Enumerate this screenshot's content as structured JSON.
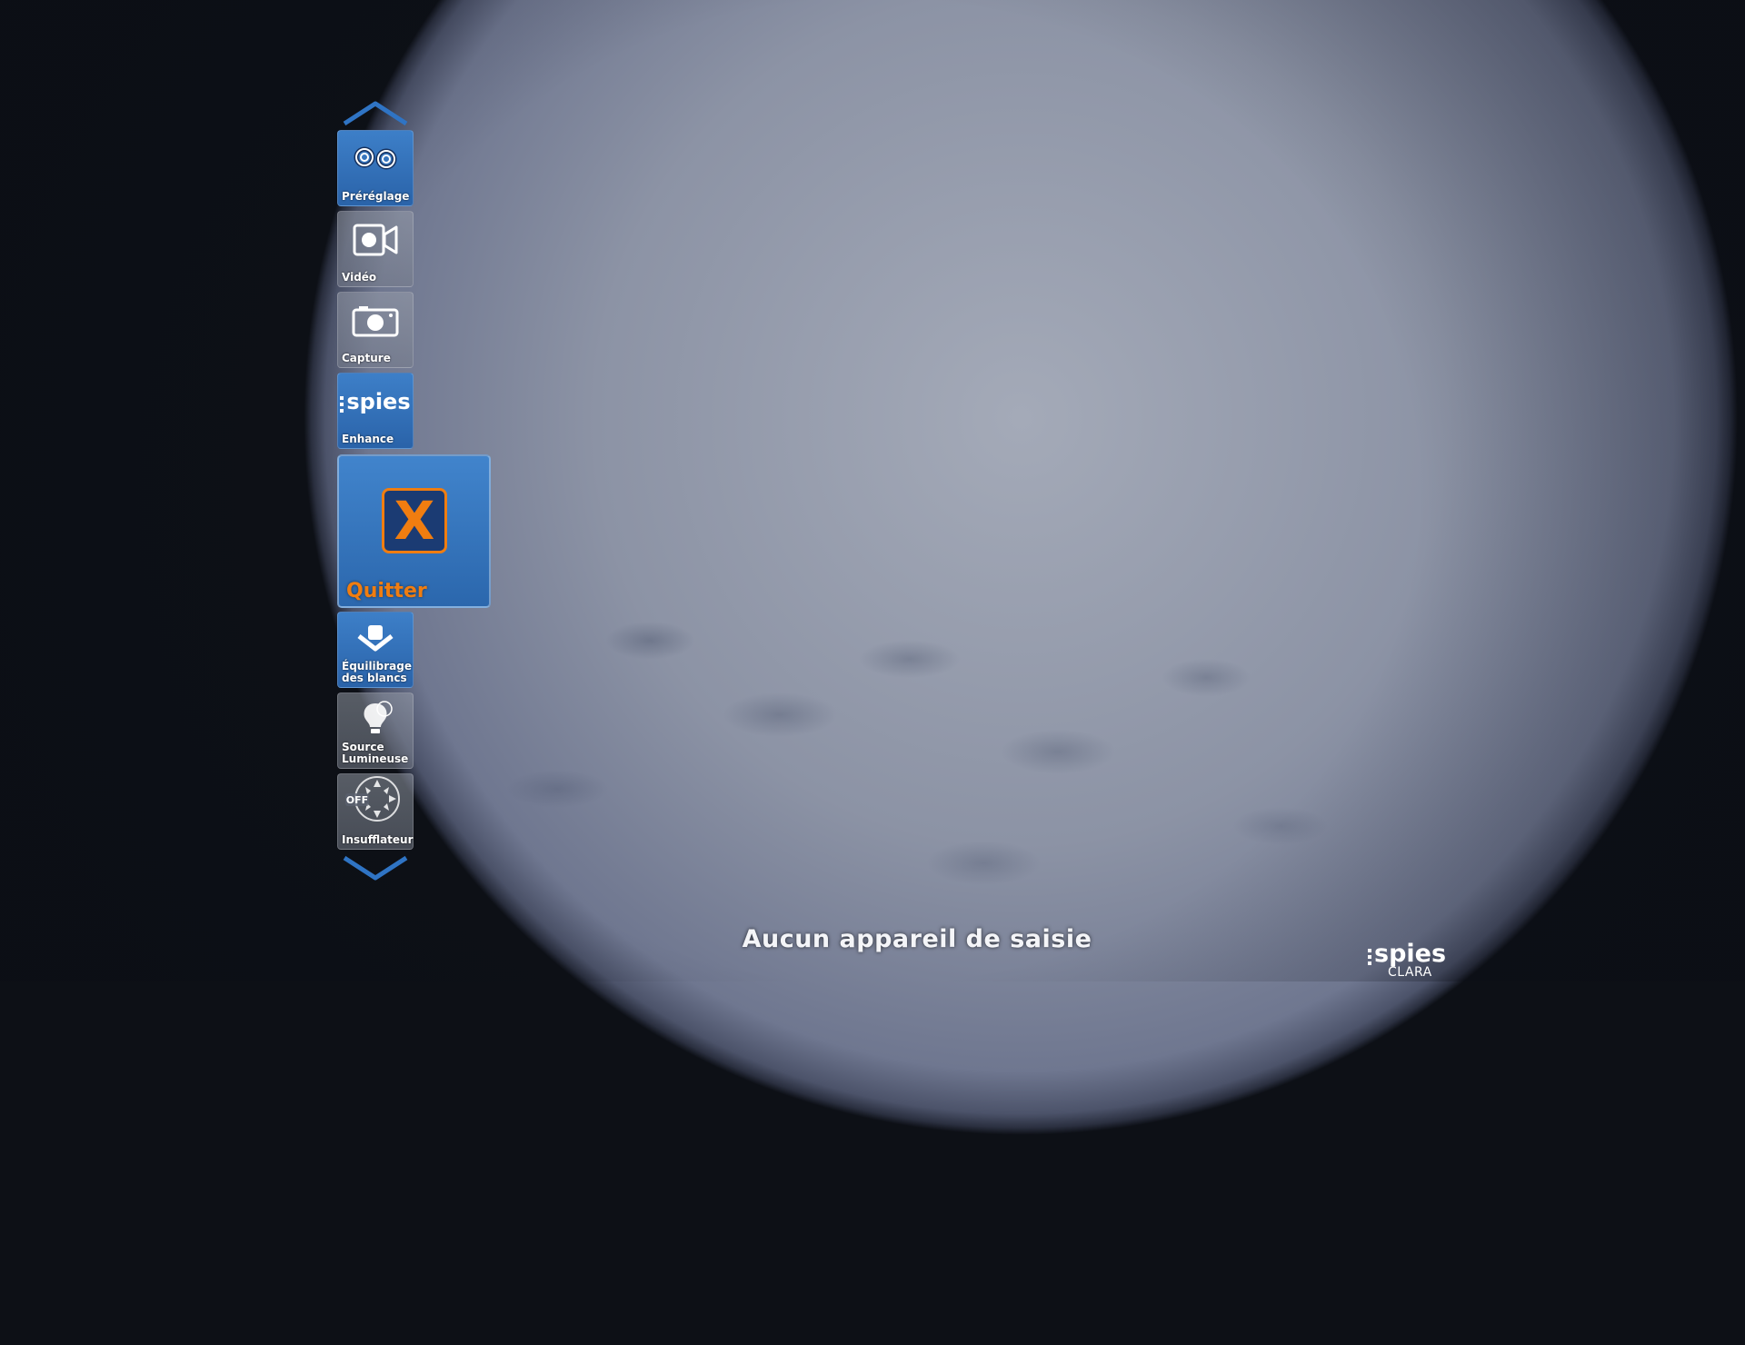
{
  "menu": {
    "tiles": [
      {
        "label": "Préréglage",
        "icon": "gears-icon",
        "active": true
      },
      {
        "label": "Vidéo",
        "icon": "video-camera-icon",
        "active": false
      },
      {
        "label": "Capture",
        "icon": "photo-camera-icon",
        "active": false
      },
      {
        "label": "Enhance",
        "icon": "spies-logo-icon",
        "icon_text": "spies",
        "active": true
      },
      {
        "label": "Équilibrage\ndes blancs",
        "icon": "white-balance-icon",
        "active": true
      },
      {
        "label": "Source\nLumineuse",
        "icon": "light-bulb-icon",
        "active": false
      },
      {
        "label": "Insufflateur",
        "icon": "insufflator-off-icon",
        "icon_text": "OFF",
        "active": false
      }
    ],
    "quit": {
      "label": "Quitter",
      "icon_text": "X"
    }
  },
  "status": {
    "message": "Aucun appareil de saisie"
  },
  "brand": {
    "name": "spies",
    "product": "CLARA"
  },
  "colors": {
    "tile_blue": "#2f6db5",
    "accent_orange": "#f07d10",
    "arrow_blue": "#2f74c4"
  }
}
